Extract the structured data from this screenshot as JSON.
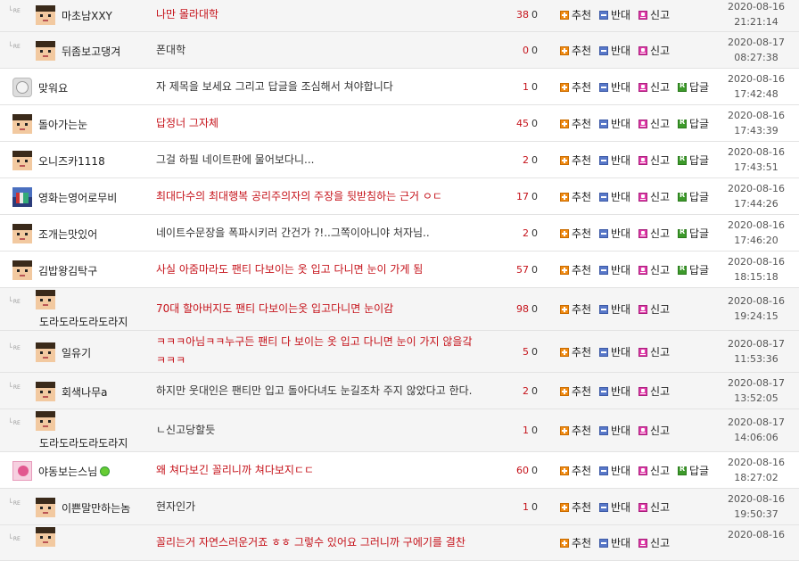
{
  "actions": {
    "recommend": "추천",
    "oppose": "반대",
    "report": "신고",
    "reply": "답글",
    "re_marker": "RE"
  },
  "comments": [
    {
      "nickname": "마초남XXY",
      "avatar": "pixel-face-icon",
      "is_reply": true,
      "title": "나만 몰라대학",
      "title_color": "red",
      "recommend_count": "38",
      "oppose_count": "0",
      "date": "2020-08-16",
      "time": "21:21:14",
      "has_reply_button": false
    },
    {
      "nickname": "뒤좀보고댕겨",
      "avatar": "pixel-face-icon",
      "is_reply": true,
      "title": "폰대학",
      "title_color": "dark",
      "recommend_count": "0",
      "oppose_count": "0",
      "date": "2020-08-17",
      "time": "08:27:38",
      "has_reply_button": false
    },
    {
      "nickname": "맞워요",
      "avatar": "round-face-icon",
      "is_reply": false,
      "title": "자 제목을 보세요 그리고 답글을 조심해서 쳐야합니다",
      "title_color": "dark",
      "recommend_count": "1",
      "oppose_count": "0",
      "date": "2020-08-16",
      "time": "17:42:48",
      "has_reply_button": true
    },
    {
      "nickname": "돌아가는눈",
      "avatar": "pixel-face-icon",
      "is_reply": false,
      "title": "답정너 그자체",
      "title_color": "red",
      "recommend_count": "45",
      "oppose_count": "0",
      "date": "2020-08-16",
      "time": "17:43:39",
      "has_reply_button": true
    },
    {
      "nickname": "오니즈카1118",
      "avatar": "pixel-face-icon",
      "is_reply": false,
      "title": "그걸 하필 네이트판에 물어보다니...",
      "title_color": "dark",
      "recommend_count": "2",
      "oppose_count": "0",
      "date": "2020-08-16",
      "time": "17:43:51",
      "has_reply_button": true
    },
    {
      "nickname": "영화는영어로무비",
      "avatar": "city-icon",
      "is_reply": false,
      "title": "최대다수의 최대행복 공리주의자의 주장을 뒷받침하는 근거 ㅇㄷ",
      "title_color": "red",
      "recommend_count": "17",
      "oppose_count": "0",
      "date": "2020-08-16",
      "time": "17:44:26",
      "has_reply_button": true
    },
    {
      "nickname": "조개는맛있어",
      "avatar": "pixel-face-icon",
      "is_reply": false,
      "title": "네이트수문장을 폭파시키러 간건가 ?!..그쪽이아니야 처자님..",
      "title_color": "dark",
      "recommend_count": "2",
      "oppose_count": "0",
      "date": "2020-08-16",
      "time": "17:46:20",
      "has_reply_button": true
    },
    {
      "nickname": "김밥왕김탁구",
      "avatar": "pixel-face-icon",
      "is_reply": false,
      "title": "사실 아줌마라도 팬티 다보이는 옷 입고 다니면 눈이 가게 됨",
      "title_color": "red",
      "recommend_count": "57",
      "oppose_count": "0",
      "date": "2020-08-16",
      "time": "18:15:18",
      "has_reply_button": true
    },
    {
      "nickname": "도라도라도라도라지",
      "avatar": "pixel-face-icon",
      "is_reply": true,
      "title": "70대 할아버지도 팬티 다보이는옷 입고다니면 눈이감",
      "title_color": "red",
      "recommend_count": "98",
      "oppose_count": "0",
      "date": "2020-08-16",
      "time": "19:24:15",
      "has_reply_button": false
    },
    {
      "nickname": "일유기",
      "avatar": "pixel-face-icon",
      "is_reply": true,
      "title": "ㅋㅋㅋ아님ㅋㅋ누구든 팬티 다 보이는 옷 입고 다니면 눈이 가지 않을갘",
      "title2": "ㅋㅋㅋ",
      "title_color": "red",
      "recommend_count": "5",
      "oppose_count": "0",
      "date": "2020-08-17",
      "time": "11:53:36",
      "has_reply_button": false
    },
    {
      "nickname": "회색나무a",
      "avatar": "pixel-face-icon",
      "is_reply": true,
      "title": "하지만 웃대인은 팬티만 입고 돌아다녀도 눈길조차 주지 않았다고 한다.",
      "title_color": "dark",
      "recommend_count": "2",
      "oppose_count": "0",
      "date": "2020-08-17",
      "time": "13:52:05",
      "has_reply_button": false
    },
    {
      "nickname": "도라도라도라도라지",
      "avatar": "pixel-face-icon",
      "is_reply": true,
      "title": "ㄴ신고당할듯",
      "title_color": "dark",
      "recommend_count": "1",
      "oppose_count": "0",
      "date": "2020-08-17",
      "time": "14:06:06",
      "has_reply_button": false
    },
    {
      "nickname": "야동보는스님",
      "avatar": "pink-monk-icon",
      "online": true,
      "is_reply": false,
      "title": "왜 쳐다보긴 꼴리니까 쳐다보지ㄷㄷ",
      "title_color": "red",
      "recommend_count": "60",
      "oppose_count": "0",
      "date": "2020-08-16",
      "time": "18:27:02",
      "has_reply_button": true
    },
    {
      "nickname": "이쁜말만하는놈",
      "avatar": "pixel-face-icon",
      "is_reply": true,
      "title": "현자인가",
      "title_color": "dark",
      "recommend_count": "1",
      "oppose_count": "0",
      "date": "2020-08-16",
      "time": "19:50:37",
      "has_reply_button": false
    },
    {
      "nickname": "",
      "avatar": "pixel-face-icon",
      "is_reply": true,
      "title": "꼴리는거 자연스러운거죠 ㅎㅎ 그렇수 있어요 그러니까 구에기를 결찬",
      "title_color": "red",
      "recommend_count": "",
      "oppose_count": "",
      "date": "2020-08-16",
      "time": "",
      "has_reply_button": false
    }
  ]
}
